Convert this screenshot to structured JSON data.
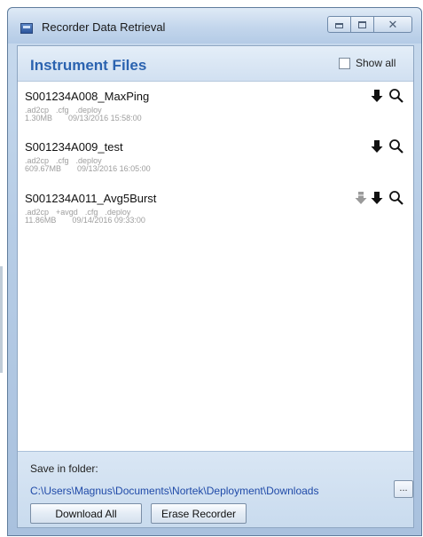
{
  "window": {
    "title": "Recorder Data Retrieval",
    "close_glyph": "✕"
  },
  "header": {
    "title": "Instrument Files",
    "show_all_label": "Show all",
    "show_all_checked": false
  },
  "files": [
    {
      "name": "S001234A008_MaxPing",
      "extensions": [
        ".ad2cp",
        ".cfg",
        ".deploy"
      ],
      "size": "1.30MB",
      "date": "09/13/2016 15:58:00",
      "extra_action": false
    },
    {
      "name": "S001234A009_test",
      "extensions": [
        ".ad2cp",
        ".cfg",
        ".deploy"
      ],
      "size": "609.67MB",
      "date": "09/13/2016 16:05:00",
      "extra_action": false
    },
    {
      "name": "S001234A011_Avg5Burst",
      "extensions": [
        ".ad2cp",
        "+avgd",
        ".cfg",
        ".deploy"
      ],
      "size": "11.86MB",
      "date": "09/14/2016 09:33:00",
      "extra_action": true
    }
  ],
  "footer": {
    "save_label": "Save in folder:",
    "folder_path": "C:\\Users\\Magnus\\Documents\\Nortek\\Deployment\\Downloads",
    "browse_label": "...",
    "download_all_label": "Download All",
    "erase_label": "Erase Recorder"
  },
  "colors": {
    "accent": "#2b63b0",
    "link": "#1f4aa8",
    "meta": "#9e9e9e"
  }
}
